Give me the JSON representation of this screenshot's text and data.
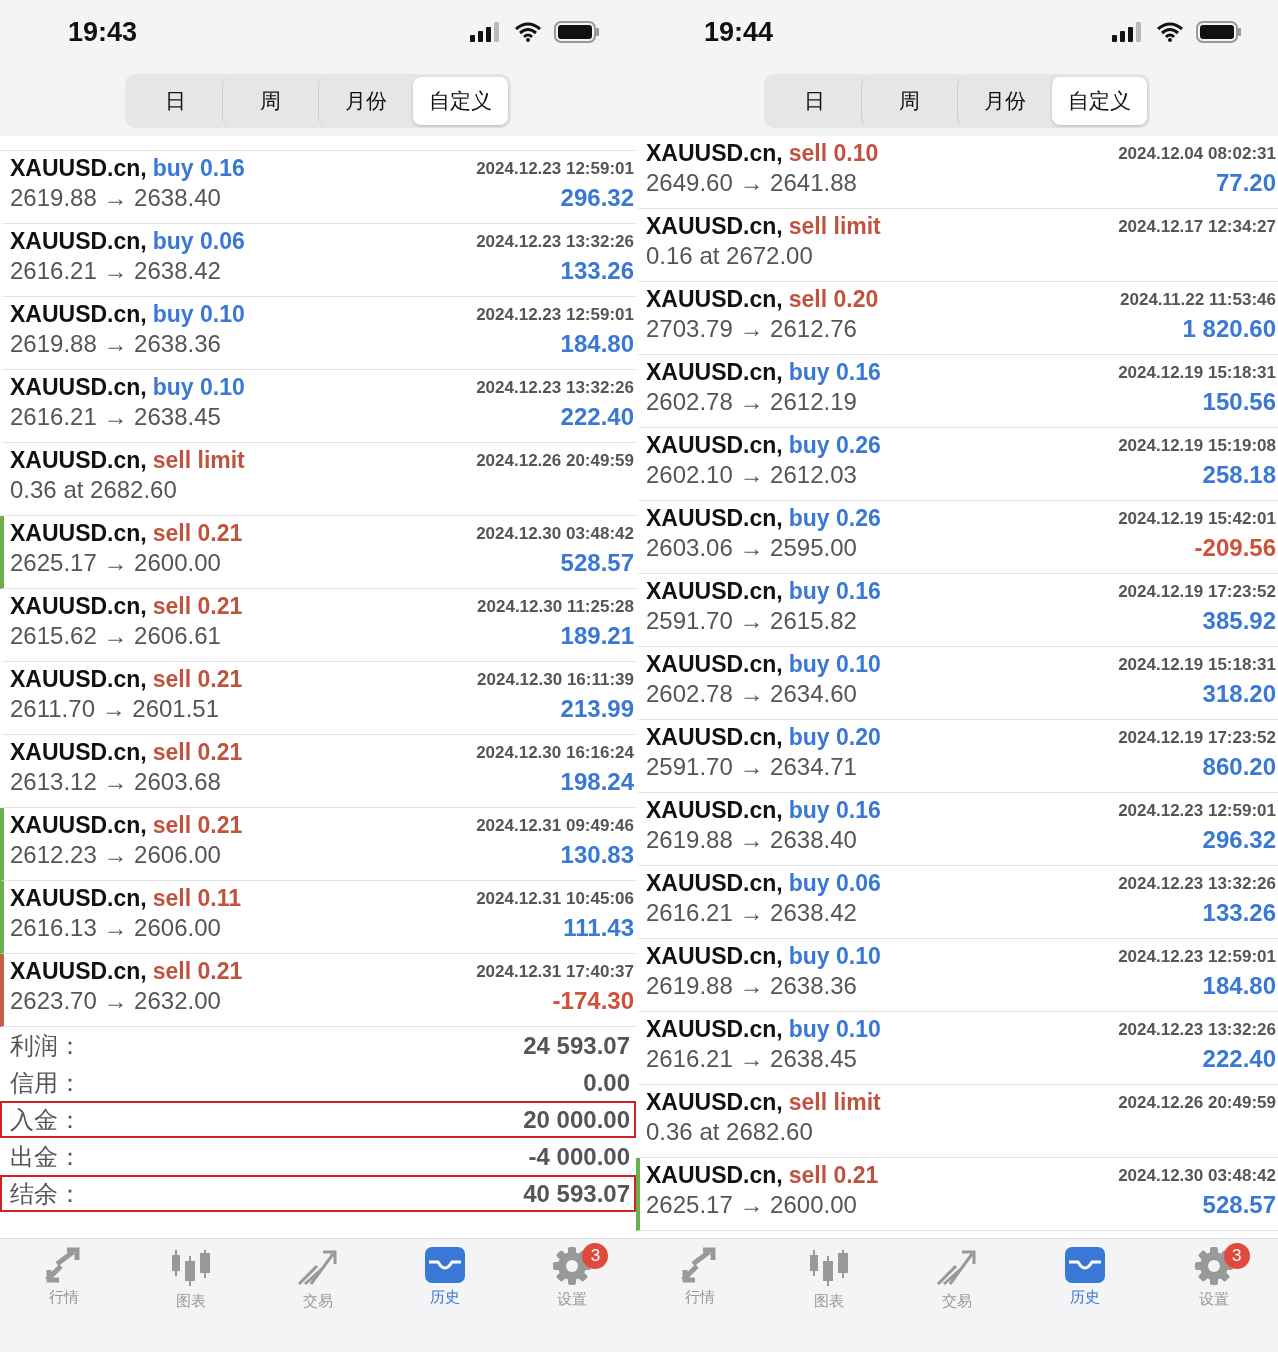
{
  "panels": [
    {
      "status_bar": {
        "time": "19:43"
      },
      "segments": [
        {
          "label": "日",
          "selected": false
        },
        {
          "label": "周",
          "selected": false
        },
        {
          "label": "月份",
          "selected": false
        },
        {
          "label": "自定义",
          "selected": true
        }
      ],
      "rows": [
        {
          "symbol": "XAUUSD.cn,",
          "kind": "buy",
          "order": "buy 0.16",
          "time": "2024.12.23 12:59:01",
          "detail": "2619.88 → 2638.40",
          "profit": "296.32",
          "loss": false
        },
        {
          "symbol": "XAUUSD.cn,",
          "kind": "buy",
          "order": "buy 0.06",
          "time": "2024.12.23 13:32:26",
          "detail": "2616.21 → 2638.42",
          "profit": "133.26",
          "loss": false
        },
        {
          "symbol": "XAUUSD.cn,",
          "kind": "buy",
          "order": "buy 0.10",
          "time": "2024.12.23 12:59:01",
          "detail": "2619.88 → 2638.36",
          "profit": "184.80",
          "loss": false
        },
        {
          "symbol": "XAUUSD.cn,",
          "kind": "buy",
          "order": "buy 0.10",
          "time": "2024.12.23 13:32:26",
          "detail": "2616.21 → 2638.45",
          "profit": "222.40",
          "loss": false
        },
        {
          "symbol": "XAUUSD.cn,",
          "kind": "sell",
          "order": "sell limit",
          "time": "2024.12.26 20:49:59",
          "detail": "0.36 at 2682.60"
        },
        {
          "symbol": "XAUUSD.cn,",
          "kind": "sell",
          "order": "sell 0.21",
          "time": "2024.12.30 03:48:42",
          "detail": "2625.17 → 2600.00",
          "profit": "528.57",
          "loss": false,
          "color": "#6ab04c"
        },
        {
          "symbol": "XAUUSD.cn,",
          "kind": "sell",
          "order": "sell 0.21",
          "time": "2024.12.30 11:25:28",
          "detail": "2615.62 → 2606.61",
          "profit": "189.21",
          "loss": false
        },
        {
          "symbol": "XAUUSD.cn,",
          "kind": "sell",
          "order": "sell 0.21",
          "time": "2024.12.30 16:11:39",
          "detail": "2611.70 → 2601.51",
          "profit": "213.99",
          "loss": false
        },
        {
          "symbol": "XAUUSD.cn,",
          "kind": "sell",
          "order": "sell 0.21",
          "time": "2024.12.30 16:16:24",
          "detail": "2613.12 → 2603.68",
          "profit": "198.24",
          "loss": false
        },
        {
          "symbol": "XAUUSD.cn,",
          "kind": "sell",
          "order": "sell 0.21",
          "time": "2024.12.31 09:49:46",
          "detail": "2612.23 → 2606.00",
          "profit": "130.83",
          "loss": false,
          "color": "#6ab04c"
        },
        {
          "symbol": "XAUUSD.cn,",
          "kind": "sell",
          "order": "sell 0.11",
          "time": "2024.12.31 10:45:06",
          "detail": "2616.13 → 2606.00",
          "profit": "111.43",
          "loss": false,
          "color": "#6ab04c"
        },
        {
          "symbol": "XAUUSD.cn,",
          "kind": "sell",
          "order": "sell 0.21",
          "time": "2024.12.31 17:40:37",
          "detail": "2623.70 → 2632.00",
          "profit": "-174.30",
          "loss": true,
          "color": "#c0604a"
        }
      ],
      "summary": [
        {
          "label": "利润：",
          "value": "24 593.07",
          "highlighted": false
        },
        {
          "label": "信用：",
          "value": "0.00",
          "highlighted": false
        },
        {
          "label": "入金：",
          "value": "20 000.00",
          "highlighted": true
        },
        {
          "label": "出金：",
          "value": "-4 000.00",
          "highlighted": false
        },
        {
          "label": "结余：",
          "value": "40 593.07",
          "highlighted": true
        }
      ],
      "tab_bar": [
        {
          "kind": "quotes",
          "label": "行情",
          "selected": false
        },
        {
          "kind": "chart",
          "label": "图表",
          "selected": false
        },
        {
          "kind": "trade",
          "label": "交易",
          "selected": false
        },
        {
          "kind": "history",
          "label": "历史",
          "selected": true
        },
        {
          "kind": "settings",
          "label": "设置",
          "selected": false,
          "badge": "3"
        }
      ]
    },
    {
      "status_bar": {
        "time": "19:44"
      },
      "segments": [
        {
          "label": "日",
          "selected": false
        },
        {
          "label": "周",
          "selected": false
        },
        {
          "label": "月份",
          "selected": false
        },
        {
          "label": "自定义",
          "selected": true
        }
      ],
      "rows": [
        {
          "symbol": "XAUUSD.cn,",
          "kind": "sell",
          "order": "sell 0.10",
          "time": "2024.12.04 08:02:31",
          "detail": "2649.60 → 2641.88",
          "profit": "77.20",
          "loss": false
        },
        {
          "symbol": "XAUUSD.cn,",
          "kind": "sell",
          "order": "sell limit",
          "time": "2024.12.17 12:34:27",
          "detail": "0.16 at 2672.00"
        },
        {
          "symbol": "XAUUSD.cn,",
          "kind": "sell",
          "order": "sell 0.20",
          "time": "2024.11.22 11:53:46",
          "detail": "2703.79 → 2612.76",
          "profit": "1 820.60",
          "loss": false
        },
        {
          "symbol": "XAUUSD.cn,",
          "kind": "buy",
          "order": "buy 0.16",
          "time": "2024.12.19 15:18:31",
          "detail": "2602.78 → 2612.19",
          "profit": "150.56",
          "loss": false
        },
        {
          "symbol": "XAUUSD.cn,",
          "kind": "buy",
          "order": "buy 0.26",
          "time": "2024.12.19 15:19:08",
          "detail": "2602.10 → 2612.03",
          "profit": "258.18",
          "loss": false
        },
        {
          "symbol": "XAUUSD.cn,",
          "kind": "buy",
          "order": "buy 0.26",
          "time": "2024.12.19 15:42:01",
          "detail": "2603.06 → 2595.00",
          "profit": "-209.56",
          "loss": true
        },
        {
          "symbol": "XAUUSD.cn,",
          "kind": "buy",
          "order": "buy 0.16",
          "time": "2024.12.19 17:23:52",
          "detail": "2591.70 → 2615.82",
          "profit": "385.92",
          "loss": false
        },
        {
          "symbol": "XAUUSD.cn,",
          "kind": "buy",
          "order": "buy 0.10",
          "time": "2024.12.19 15:18:31",
          "detail": "2602.78 → 2634.60",
          "profit": "318.20",
          "loss": false
        },
        {
          "symbol": "XAUUSD.cn,",
          "kind": "buy",
          "order": "buy 0.20",
          "time": "2024.12.19 17:23:52",
          "detail": "2591.70 → 2634.71",
          "profit": "860.20",
          "loss": false
        },
        {
          "symbol": "XAUUSD.cn,",
          "kind": "buy",
          "order": "buy 0.16",
          "time": "2024.12.23 12:59:01",
          "detail": "2619.88 → 2638.40",
          "profit": "296.32",
          "loss": false
        },
        {
          "symbol": "XAUUSD.cn,",
          "kind": "buy",
          "order": "buy 0.06",
          "time": "2024.12.23 13:32:26",
          "detail": "2616.21 → 2638.42",
          "profit": "133.26",
          "loss": false
        },
        {
          "symbol": "XAUUSD.cn,",
          "kind": "buy",
          "order": "buy 0.10",
          "time": "2024.12.23 12:59:01",
          "detail": "2619.88 → 2638.36",
          "profit": "184.80",
          "loss": false
        },
        {
          "symbol": "XAUUSD.cn,",
          "kind": "buy",
          "order": "buy 0.10",
          "time": "2024.12.23 13:32:26",
          "detail": "2616.21 → 2638.45",
          "profit": "222.40",
          "loss": false
        },
        {
          "symbol": "XAUUSD.cn,",
          "kind": "sell",
          "order": "sell limit",
          "time": "2024.12.26 20:49:59",
          "detail": "0.36 at 2682.60"
        },
        {
          "symbol": "XAUUSD.cn,",
          "kind": "sell",
          "order": "sell 0.21",
          "time": "2024.12.30 03:48:42",
          "detail": "2625.17 → 2600.00",
          "profit": "528.57",
          "loss": false,
          "color": "#6ab04c"
        }
      ],
      "tab_bar": [
        {
          "kind": "quotes",
          "label": "行情",
          "selected": false
        },
        {
          "kind": "chart",
          "label": "图表",
          "selected": false
        },
        {
          "kind": "trade",
          "label": "交易",
          "selected": false
        },
        {
          "kind": "history",
          "label": "历史",
          "selected": true
        },
        {
          "kind": "settings",
          "label": "设置",
          "selected": false,
          "badge": "3"
        }
      ]
    }
  ]
}
